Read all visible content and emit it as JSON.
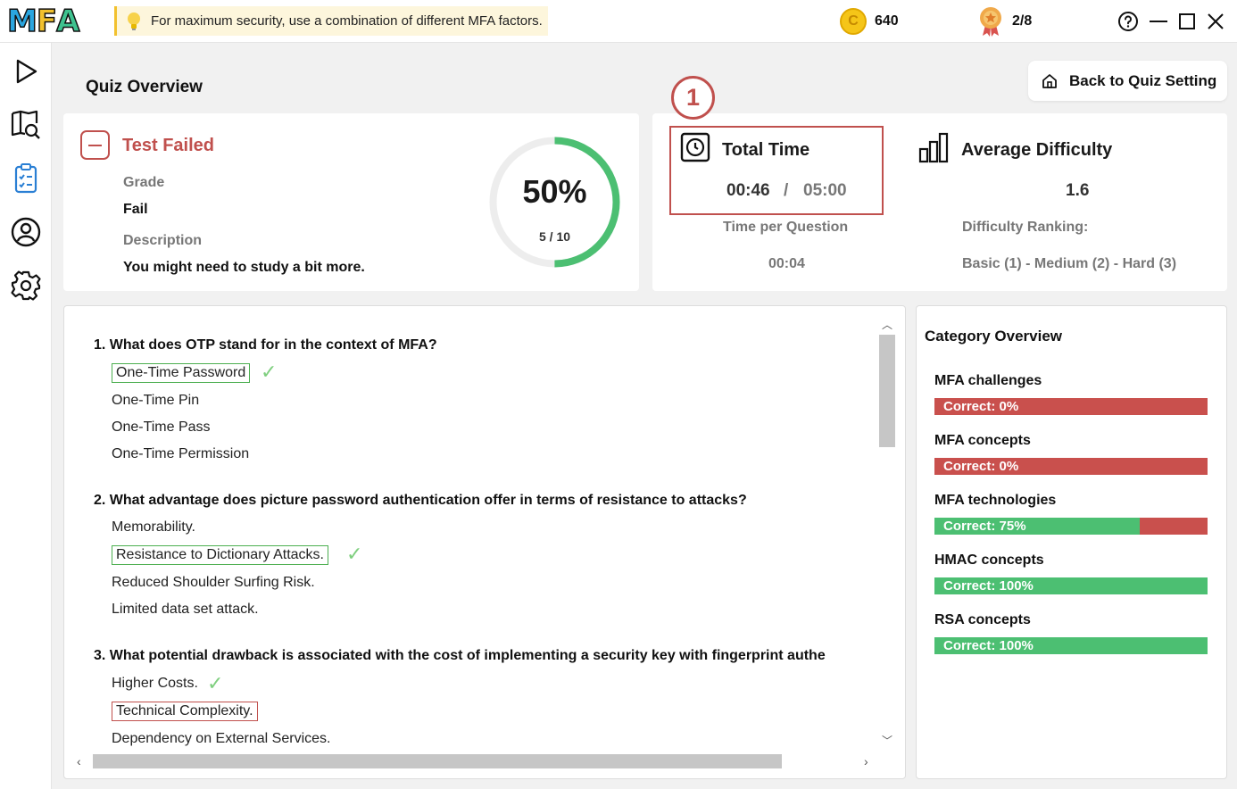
{
  "topbar": {
    "logo_parts": [
      "M",
      "F",
      "A"
    ],
    "tip": "For maximum security, use a combination of different MFA factors.",
    "coin_symbol": "C",
    "coins": "640",
    "badges": "2/8"
  },
  "sidebar": {
    "items": [
      {
        "name": "play",
        "icon": "play-icon"
      },
      {
        "name": "map-search",
        "icon": "map-search-icon"
      },
      {
        "name": "quiz",
        "icon": "checklist-icon",
        "active": true
      },
      {
        "name": "profile",
        "icon": "user-icon"
      },
      {
        "name": "settings",
        "icon": "gear-icon"
      }
    ]
  },
  "header": {
    "title": "Quiz Overview",
    "back_label": "Back to Quiz Setting"
  },
  "result": {
    "status": "Test Failed",
    "grade_label": "Grade",
    "grade": "Fail",
    "description_label": "Description",
    "description": "You might need to study a bit more.",
    "percent_text": "50%",
    "percent": 0.5,
    "count": "5 / 10"
  },
  "timing": {
    "callout": "1",
    "total_time_label": "Total Time",
    "elapsed": "00:46",
    "separator": "/",
    "limit": "05:00",
    "per_question_label": "Time per Question",
    "per_question": "00:04",
    "avg_difficulty_label": "Average Difficulty",
    "avg_difficulty": "1.6",
    "ranking_label": "Difficulty Ranking:",
    "ranking": "Basic (1) - Medium (2) - Hard (3)"
  },
  "questions": [
    {
      "title": "1. What does OTP stand for in the context of MFA?",
      "options": [
        {
          "text": "One-Time Password",
          "state": "selected-correct"
        },
        {
          "text": "One-Time Pin",
          "state": "none"
        },
        {
          "text": "One-Time Pass",
          "state": "none"
        },
        {
          "text": "One-Time Permission",
          "state": "none"
        }
      ]
    },
    {
      "title": "2. What advantage does picture password authentication offer in terms of resistance to attacks?",
      "options": [
        {
          "text": "Memorability.",
          "state": "none"
        },
        {
          "text": "Resistance to Dictionary Attacks.",
          "state": "selected-correct"
        },
        {
          "text": "Reduced Shoulder Surfing Risk.",
          "state": "none"
        },
        {
          "text": "Limited data set attack.",
          "state": "none"
        }
      ]
    },
    {
      "title": "3. What potential drawback is associated with the cost of implementing a security key with fingerprint authe",
      "options": [
        {
          "text": "Higher Costs.",
          "state": "correct"
        },
        {
          "text": "Technical Complexity.",
          "state": "selected-wrong"
        },
        {
          "text": "Dependency on External Services.",
          "state": "none"
        }
      ]
    }
  ],
  "categories": {
    "title": "Category Overview",
    "items": [
      {
        "name": "MFA challenges",
        "label": "Correct: 0%",
        "correct": 0.0
      },
      {
        "name": "MFA concepts",
        "label": "Correct: 0%",
        "correct": 0.0
      },
      {
        "name": "MFA technologies",
        "label": "Correct: 75%",
        "correct": 0.75
      },
      {
        "name": "HMAC concepts",
        "label": "Correct: 100%",
        "correct": 1.0
      },
      {
        "name": "RSA concepts",
        "label": "Correct: 100%",
        "correct": 1.0
      }
    ]
  },
  "colors": {
    "fail": "#c0504d",
    "success": "#4cbf72",
    "accent": "#2a7fd4"
  }
}
